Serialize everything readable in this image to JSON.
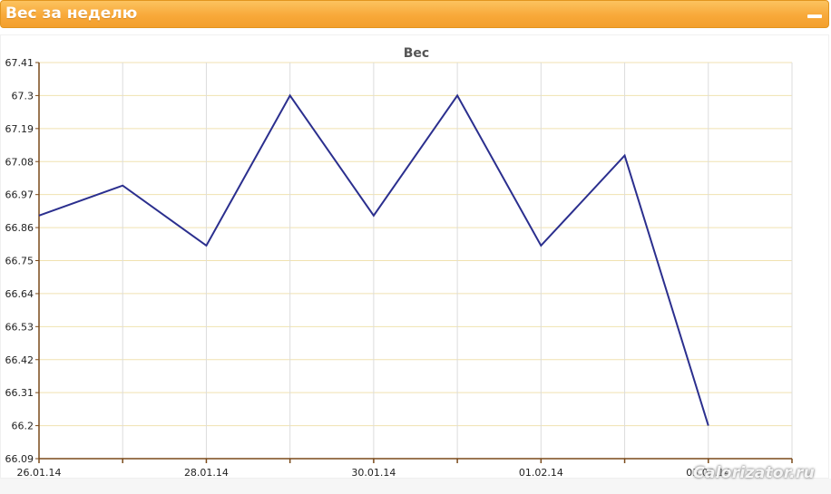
{
  "panel": {
    "title": "Вес за неделю"
  },
  "watermark": "Calorizator.ru",
  "colors": {
    "line": "#2b2f8e",
    "grid": "#f0e2b0",
    "vgrid": "#dcdcdc",
    "axis": "#7a4a1a",
    "header": "#f8a93a"
  },
  "chart_data": {
    "type": "line",
    "title": "Вес",
    "xlabel": "",
    "ylabel": "",
    "ylim": [
      66.09,
      67.41
    ],
    "yticks": [
      "67.41",
      "67.3",
      "67.19",
      "67.08",
      "66.97",
      "66.86",
      "66.75",
      "66.64",
      "66.53",
      "66.42",
      "66.31",
      "66.2",
      "66.09"
    ],
    "x_count": 10,
    "xtick_labels": [
      {
        "index": 0,
        "label": "26.01.14"
      },
      {
        "index": 2,
        "label": "28.01.14"
      },
      {
        "index": 4,
        "label": "30.01.14"
      },
      {
        "index": 6,
        "label": "01.02.14"
      },
      {
        "index": 8,
        "label": "03.02.14"
      }
    ],
    "series": [
      {
        "values": [
          66.9,
          67.0,
          66.8,
          67.3,
          66.9,
          67.3,
          66.8,
          67.1,
          66.2
        ]
      }
    ],
    "grid": true,
    "legend": "none"
  }
}
